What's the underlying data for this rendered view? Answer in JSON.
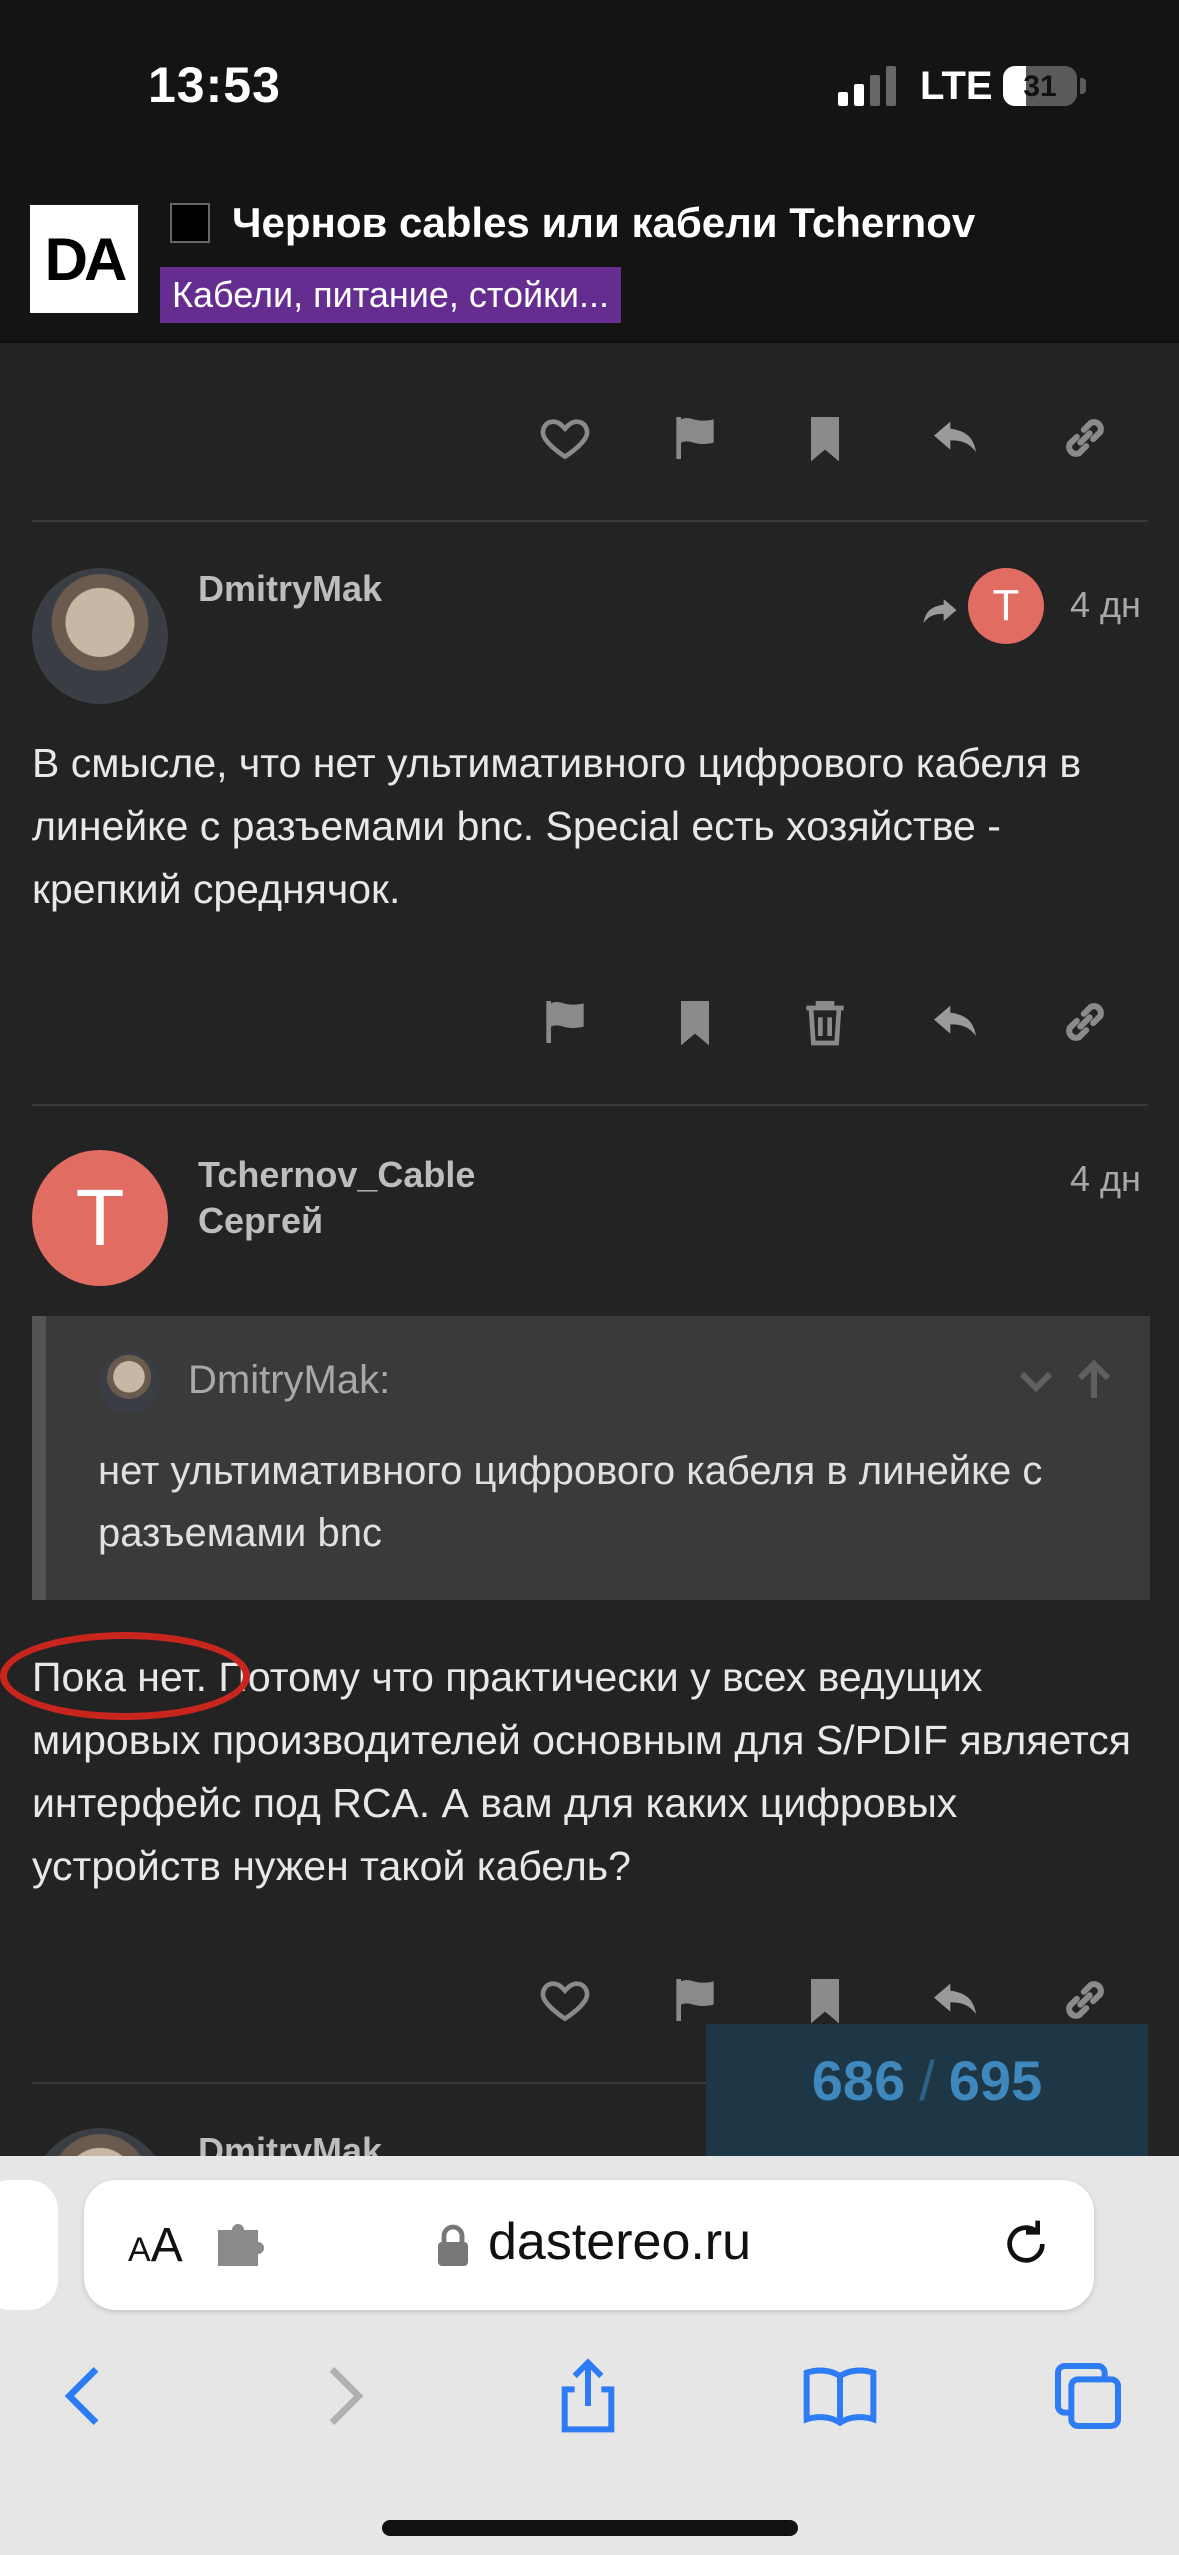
{
  "status_bar": {
    "time": "13:53",
    "network": "LTE",
    "battery": "31",
    "battery_level": 0.31
  },
  "header": {
    "logo": "DA",
    "topic_title": "Чернов cables или кабели Tchernov",
    "category": "Кабели, питание, стойки...",
    "category_color": "#652d90"
  },
  "posts": [
    {
      "username": "DmitryMak",
      "date": "4 дн",
      "reply_to_avatar_letter": "T",
      "text": "В смысле, что нет ультимативного цифрового кабеля в линейке с разъемами bnc. Special есть хозяйстве - крепкий среднячок."
    },
    {
      "avatar_letter": "T",
      "username": "Tchernov_Cable",
      "full_name": "Сергей",
      "date": "4 дн",
      "quote": {
        "author": "DmitryMak:",
        "text": "нет ультимативного цифрового кабеля в линейке с разъемами bnc"
      },
      "text": "Пока нет. Потому что практически у всех ведущих мировых производителей основным для S/PDIF является интерфейс под RCA. А вам для каких цифровых устройств нужен такой кабель?"
    },
    {
      "username": "DmitryMak"
    }
  ],
  "progress": {
    "current": "686",
    "separator": "/",
    "total": "695"
  },
  "browser": {
    "aa_small": "A",
    "aa_large": "A",
    "url": "dastereo.ru"
  },
  "icons": [
    "heart-icon",
    "flag-icon",
    "bookmark-icon",
    "reply-icon",
    "link-icon",
    "trash-icon",
    "lock-icon",
    "reload-icon",
    "back-icon",
    "forward-icon",
    "share-icon",
    "bookmarks-icon",
    "tabs-icon"
  ]
}
